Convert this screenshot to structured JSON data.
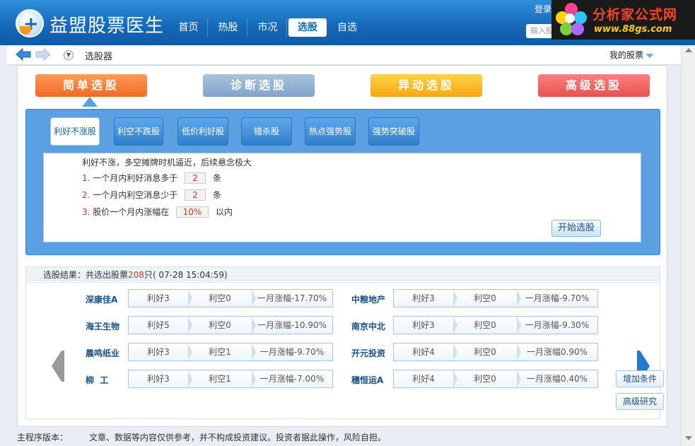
{
  "header": {
    "app_title": "益盟股票医生",
    "nav": [
      "首页",
      "热股",
      "市况",
      "选股",
      "自选"
    ],
    "active_nav": "选股",
    "login": "登录",
    "search_placeholder": "输入股",
    "brand": {
      "name": "分析家公式网",
      "url": "www.88gs.com"
    }
  },
  "breadcrumb": {
    "title": "选股器",
    "my_stocks": "我的股票"
  },
  "top_tabs": [
    "简单选股",
    "诊断选股",
    "异动选股",
    "高级选股"
  ],
  "active_top_tab": "简单选股",
  "sub_tabs": [
    "利好不涨股",
    "利空不跌股",
    "低价利好股",
    "错杀股",
    "热点强势股",
    "强势突破股"
  ],
  "active_sub_tab": "利好不涨股",
  "criteria": {
    "description": "利好不涨，多空摊牌时机逼近，后续悬念极大",
    "rows": [
      {
        "num": "1.",
        "prefix": "一个月内利好消息多于",
        "value": "2",
        "suffix": "条"
      },
      {
        "num": "2.",
        "prefix": "一个月内利空消息少于",
        "value": "2",
        "suffix": "条"
      },
      {
        "num": "3.",
        "prefix": "股价一个月内涨幅在",
        "value": "10%",
        "suffix": "以内"
      }
    ],
    "start_button": "开始选股"
  },
  "result": {
    "prefix": "选股结果：共选出股票",
    "count": "208",
    "suffix": "只",
    "time": "( 07-28 15:04:59)"
  },
  "stocks_left": [
    {
      "name": "深康佳A",
      "good": "利好3",
      "bad": "利空0",
      "change": "一月涨幅-17.70%"
    },
    {
      "name": "海王生物",
      "good": "利好5",
      "bad": "利空0",
      "change": "一月涨幅-10.90%"
    },
    {
      "name": "晨鸣纸业",
      "good": "利好3",
      "bad": "利空1",
      "change": "一月涨幅-9.70%"
    },
    {
      "name": "柳  工",
      "good": "利好3",
      "bad": "利空1",
      "change": "一月涨幅-7.00%"
    }
  ],
  "stocks_right": [
    {
      "name": "中粮地产",
      "good": "利好3",
      "bad": "利空0",
      "change": "一月涨幅-9.70%"
    },
    {
      "name": "南京中北",
      "good": "利好3",
      "bad": "利空0",
      "change": "一月涨幅-9.30%"
    },
    {
      "name": "开元投资",
      "good": "利好4",
      "bad": "利空0",
      "change": "一月涨幅0.90%"
    },
    {
      "name": "穗恒运A",
      "good": "利好4",
      "bad": "利空0",
      "change": "一月涨幅0.40%"
    }
  ],
  "side_buttons": [
    "增加条件",
    "高级研究"
  ],
  "footer": {
    "version_label": "主程序版本：",
    "disclaimer": "文章、数据等内容仅供参考，并不构成投资建议。投资者据此操作，风险自担。"
  }
}
